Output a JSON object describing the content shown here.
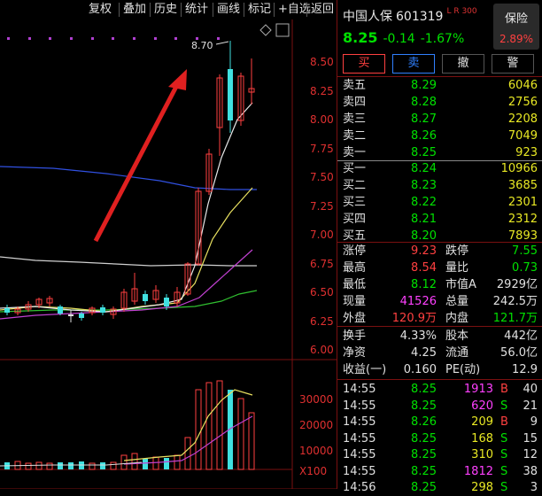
{
  "toolbar": {
    "items": [
      "复权",
      "叠加",
      "历史",
      "统计",
      "画线",
      "标记",
      "+自选",
      "返回"
    ]
  },
  "chart": {
    "y_labels": [
      "8.50",
      "8.25",
      "8.00",
      "7.75",
      "7.50",
      "7.25",
      "7.00",
      "6.75",
      "6.50",
      "6.25",
      "6.00"
    ],
    "high_annotation": "8.70",
    "vol_labels": [
      "30000",
      "20000",
      "10000",
      "X100"
    ]
  },
  "stock": {
    "name": "中国人保",
    "code": "601319",
    "tag": "L R 300",
    "badge_label": "保险",
    "badge_value": "2.89%",
    "price": "8.25",
    "change": "-0.14",
    "change_pct": "-1.67%"
  },
  "trade_buttons": [
    "买",
    "卖",
    "撤",
    "警"
  ],
  "asks": [
    {
      "label": "卖五",
      "price": "8.29",
      "vol": "6046"
    },
    {
      "label": "卖四",
      "price": "8.28",
      "vol": "2756"
    },
    {
      "label": "卖三",
      "price": "8.27",
      "vol": "2208"
    },
    {
      "label": "卖二",
      "price": "8.26",
      "vol": "7049"
    },
    {
      "label": "卖一",
      "price": "8.25",
      "vol": "923"
    }
  ],
  "bids": [
    {
      "label": "买一",
      "price": "8.24",
      "vol": "10966"
    },
    {
      "label": "买二",
      "price": "8.23",
      "vol": "3685"
    },
    {
      "label": "买三",
      "price": "8.22",
      "vol": "2301"
    },
    {
      "label": "买四",
      "price": "8.21",
      "vol": "2312"
    },
    {
      "label": "买五",
      "price": "8.20",
      "vol": "7893"
    }
  ],
  "quote": [
    {
      "l1": "涨停",
      "v1": "9.23",
      "c1": "#ff4040",
      "l2": "跌停",
      "v2": "7.55",
      "c2": "#00e000"
    },
    {
      "l1": "最高",
      "v1": "8.54",
      "c1": "#ff4040",
      "l2": "量比",
      "v2": "0.73",
      "c2": "#00e000"
    },
    {
      "l1": "最低",
      "v1": "8.12",
      "c1": "#00e000",
      "l2": "市值A",
      "v2": "2929亿",
      "c2": "#e0e0e0"
    },
    {
      "l1": "现量",
      "v1": "41526",
      "c1": "#ff40ff",
      "l2": "总量",
      "v2": "242.5万",
      "c2": "#e0e0e0"
    },
    {
      "l1": "外盘",
      "v1": "120.9万",
      "c1": "#ff4040",
      "l2": "内盘",
      "v2": "121.7万",
      "c2": "#00e000"
    }
  ],
  "stats": [
    {
      "l1": "换手",
      "v1": "4.33%",
      "l2": "股本",
      "v2": "442亿"
    },
    {
      "l1": "净资",
      "v1": "4.25",
      "l2": "流通",
      "v2": "56.0亿"
    },
    {
      "l1": "收益(一)",
      "v1": "0.160",
      "l2": "PE(动)",
      "v2": "12.9"
    }
  ],
  "ticks": [
    {
      "time": "14:55",
      "price": "8.25",
      "vol": "1913",
      "vc": "#ff40ff",
      "dir": "B",
      "dc": "#ff4040",
      "n": "40"
    },
    {
      "time": "14:55",
      "price": "8.25",
      "vol": "620",
      "vc": "#ff40ff",
      "dir": "S",
      "dc": "#00e000",
      "n": "21"
    },
    {
      "time": "14:55",
      "price": "8.26",
      "vol": "209",
      "vc": "#e8e824",
      "dir": "B",
      "dc": "#ff4040",
      "n": "9"
    },
    {
      "time": "14:55",
      "price": "8.25",
      "vol": "168",
      "vc": "#e8e824",
      "dir": "S",
      "dc": "#00e000",
      "n": "15"
    },
    {
      "time": "14:55",
      "price": "8.25",
      "vol": "310",
      "vc": "#e8e824",
      "dir": "S",
      "dc": "#00e000",
      "n": "12"
    },
    {
      "time": "14:55",
      "price": "8.25",
      "vol": "1812",
      "vc": "#ff40ff",
      "dir": "S",
      "dc": "#00e000",
      "n": "38"
    },
    {
      "time": "14:56",
      "price": "8.25",
      "vol": "298",
      "vc": "#e8e824",
      "dir": "S",
      "dc": "#00e000",
      "n": "3"
    }
  ]
}
